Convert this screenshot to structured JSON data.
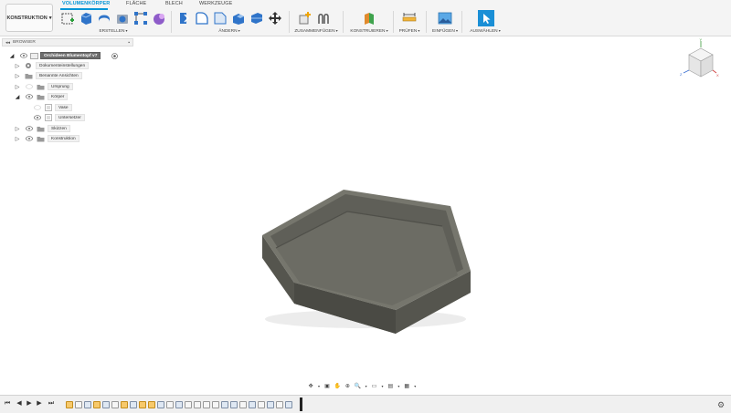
{
  "toolbar": {
    "workspace": "KONSTRUKTION",
    "tabs": [
      {
        "label": "VOLUMENKÖRPER",
        "active": true
      },
      {
        "label": "FLÄCHE",
        "active": false
      },
      {
        "label": "BLECH",
        "active": false
      },
      {
        "label": "WERKZEUGE",
        "active": false
      }
    ],
    "groups": [
      {
        "label": "ERSTELLEN"
      },
      {
        "label": "ÄNDERN"
      },
      {
        "label": "ZUSAMMENFÜGEN"
      },
      {
        "label": "KONSTRUIEREN"
      },
      {
        "label": "PRÜFEN"
      },
      {
        "label": "EINFÜGEN"
      },
      {
        "label": "AUSWÄHLEN"
      }
    ],
    "colors": {
      "accent": "#0696d7"
    }
  },
  "browser": {
    "title": "BROWSER",
    "root": "Orchideen Blumentopf v7",
    "items": [
      {
        "label": "Dokumenteinstellungen",
        "icon": "gear-icon"
      },
      {
        "label": "Benannte Ansichten",
        "icon": "folder-icon"
      },
      {
        "label": "Ursprung",
        "icon": "folder-icon"
      },
      {
        "label": "Körper",
        "icon": "folder-icon",
        "expanded": true
      },
      {
        "label": "Vase",
        "icon": "body-icon",
        "hidden": true
      },
      {
        "label": "Untersetzer",
        "icon": "body-icon"
      },
      {
        "label": "Skizzen",
        "icon": "folder-icon"
      },
      {
        "label": "Konstruktion",
        "icon": "folder-icon"
      }
    ]
  },
  "viewcube": {
    "x_label": "X",
    "y_label": "Y",
    "z_label": "Z"
  },
  "model": {
    "color": "#6a6a62",
    "shape": "hexagonal tray"
  },
  "timeline": {
    "icons": [
      "first-icon",
      "prev-icon",
      "play-icon",
      "next-icon",
      "last-icon",
      "settings-icon"
    ]
  }
}
